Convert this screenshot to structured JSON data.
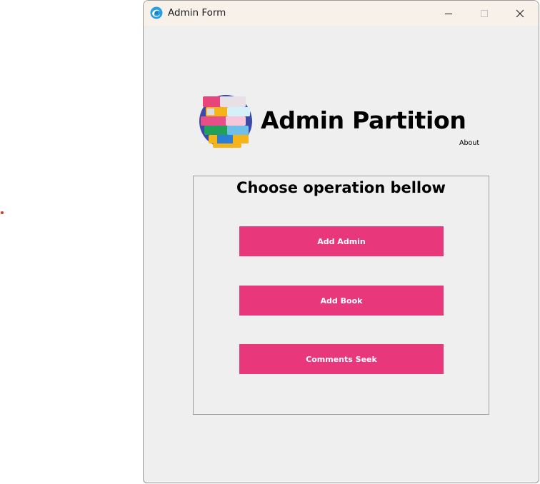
{
  "window": {
    "title": "Admin Form",
    "app_icon": "app-swirl-icon",
    "controls": {
      "minimize": "minimize-icon",
      "maximize": "maximize-icon",
      "close": "close-icon"
    }
  },
  "header": {
    "logo": "books-stack-logo",
    "title": "Admin Partition",
    "about_label": "About"
  },
  "operations": {
    "heading": "Choose operation bellow",
    "buttons": [
      {
        "label": "Add Admin"
      },
      {
        "label": "Add Book"
      },
      {
        "label": "Comments Seek"
      }
    ]
  },
  "colors": {
    "button_bg": "#e8387b",
    "button_text": "#ffffff",
    "window_bg": "#f0eff0",
    "titlebar_bg": "#f7f1ea"
  }
}
